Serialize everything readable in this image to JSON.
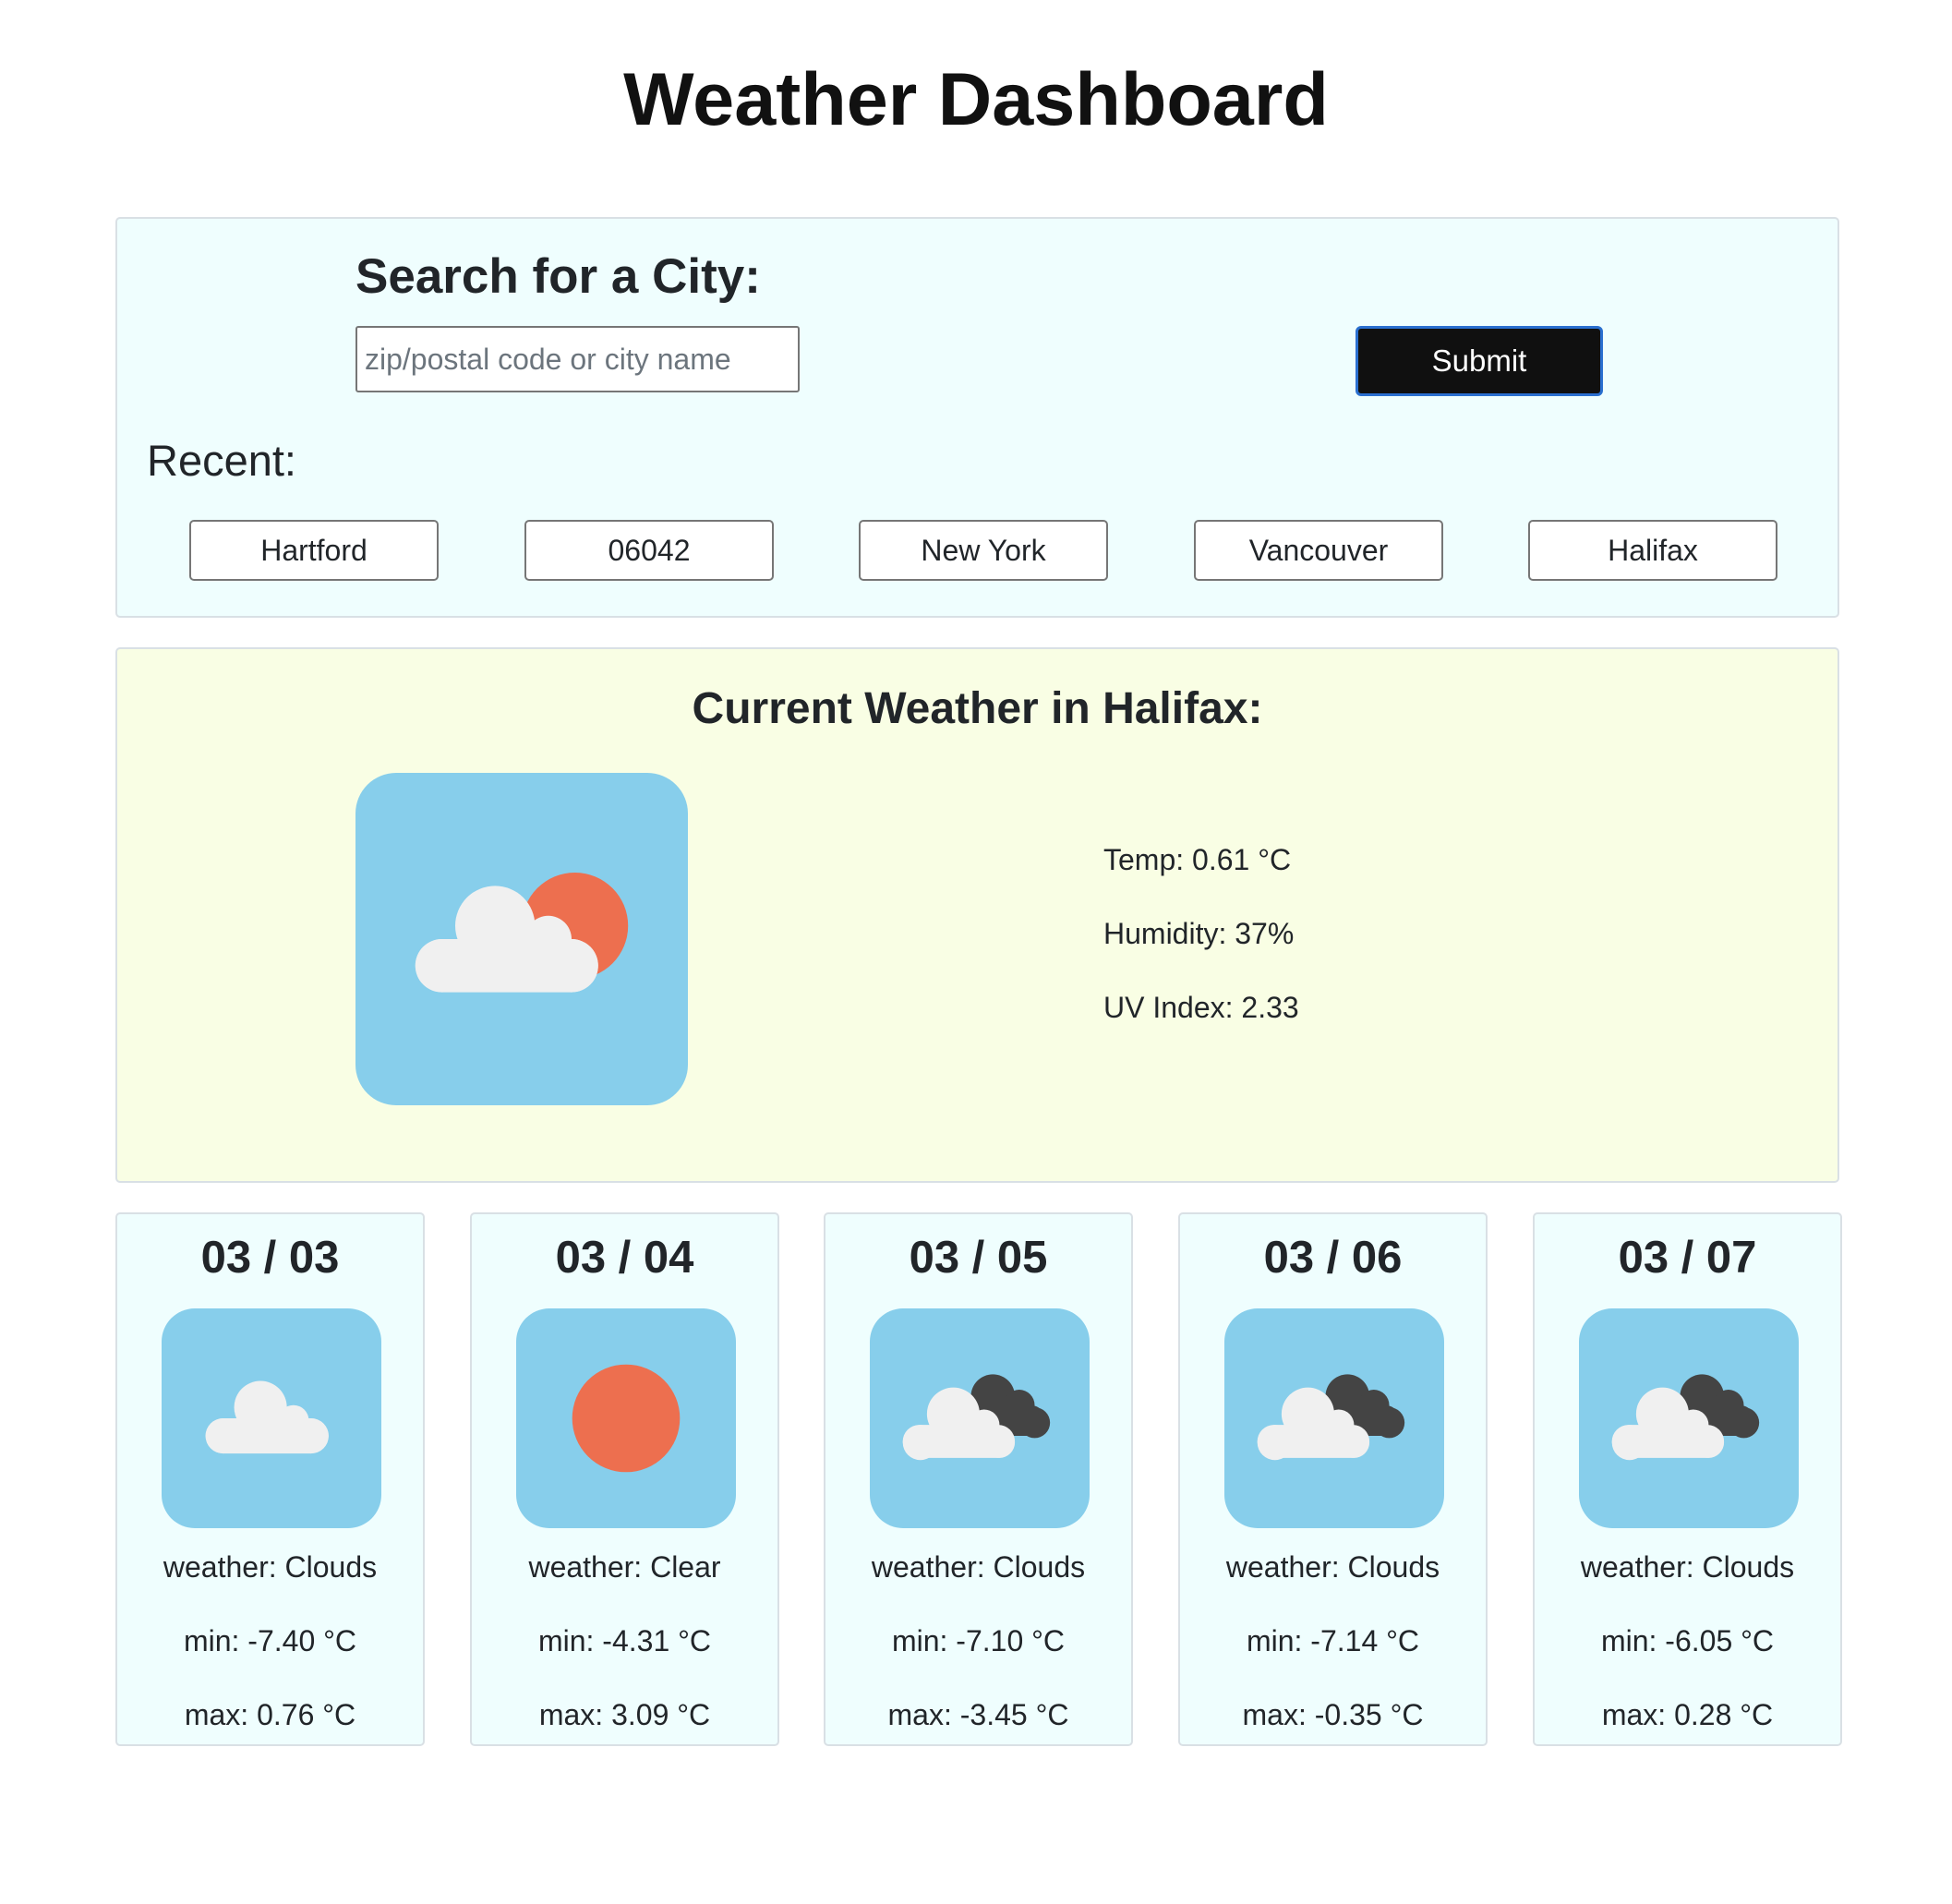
{
  "page": {
    "title": "Weather Dashboard"
  },
  "search": {
    "heading": "Search for a City:",
    "placeholder": "zip/postal code or city name",
    "value": "",
    "submit_label": "Submit"
  },
  "recent": {
    "heading": "Recent:",
    "items": [
      {
        "label": "Hartford"
      },
      {
        "label": "06042"
      },
      {
        "label": "New York"
      },
      {
        "label": "Vancouver"
      },
      {
        "label": "Halifax"
      }
    ]
  },
  "current": {
    "heading": "Current Weather in Halifax:",
    "icon": "partly-cloudy-icon",
    "temp": "Temp: 0.61 °C",
    "humidity": "Humidity: 37%",
    "uv": "UV Index: 2.33"
  },
  "forecast": [
    {
      "date": "03 / 03",
      "icon": "cloud-icon",
      "weather": "weather: Clouds",
      "min": "min: -7.40 °C",
      "max": "max: 0.76 °C"
    },
    {
      "date": "03 / 04",
      "icon": "sun-icon",
      "weather": "weather: Clear",
      "min": "min: -4.31 °C",
      "max": "max: 3.09 °C"
    },
    {
      "date": "03 / 05",
      "icon": "broken-clouds-icon",
      "weather": "weather: Clouds",
      "min": "min: -7.10 °C",
      "max": "max: -3.45 °C"
    },
    {
      "date": "03 / 06",
      "icon": "broken-clouds-icon",
      "weather": "weather: Clouds",
      "min": "min: -7.14 °C",
      "max": "max: -0.35 °C"
    },
    {
      "date": "03 / 07",
      "icon": "broken-clouds-icon",
      "weather": "weather: Clouds",
      "min": "min: -6.05 °C",
      "max": "max: 0.28 °C"
    }
  ],
  "colors": {
    "search_panel_bg": "#effefe",
    "current_panel_bg": "#f9fee4",
    "icon_tile_bg": "#87ceeb",
    "sun": "#ed6f4f",
    "cloud_light": "#f0f0f0",
    "cloud_dark": "#444444",
    "submit_bg": "#101010"
  }
}
